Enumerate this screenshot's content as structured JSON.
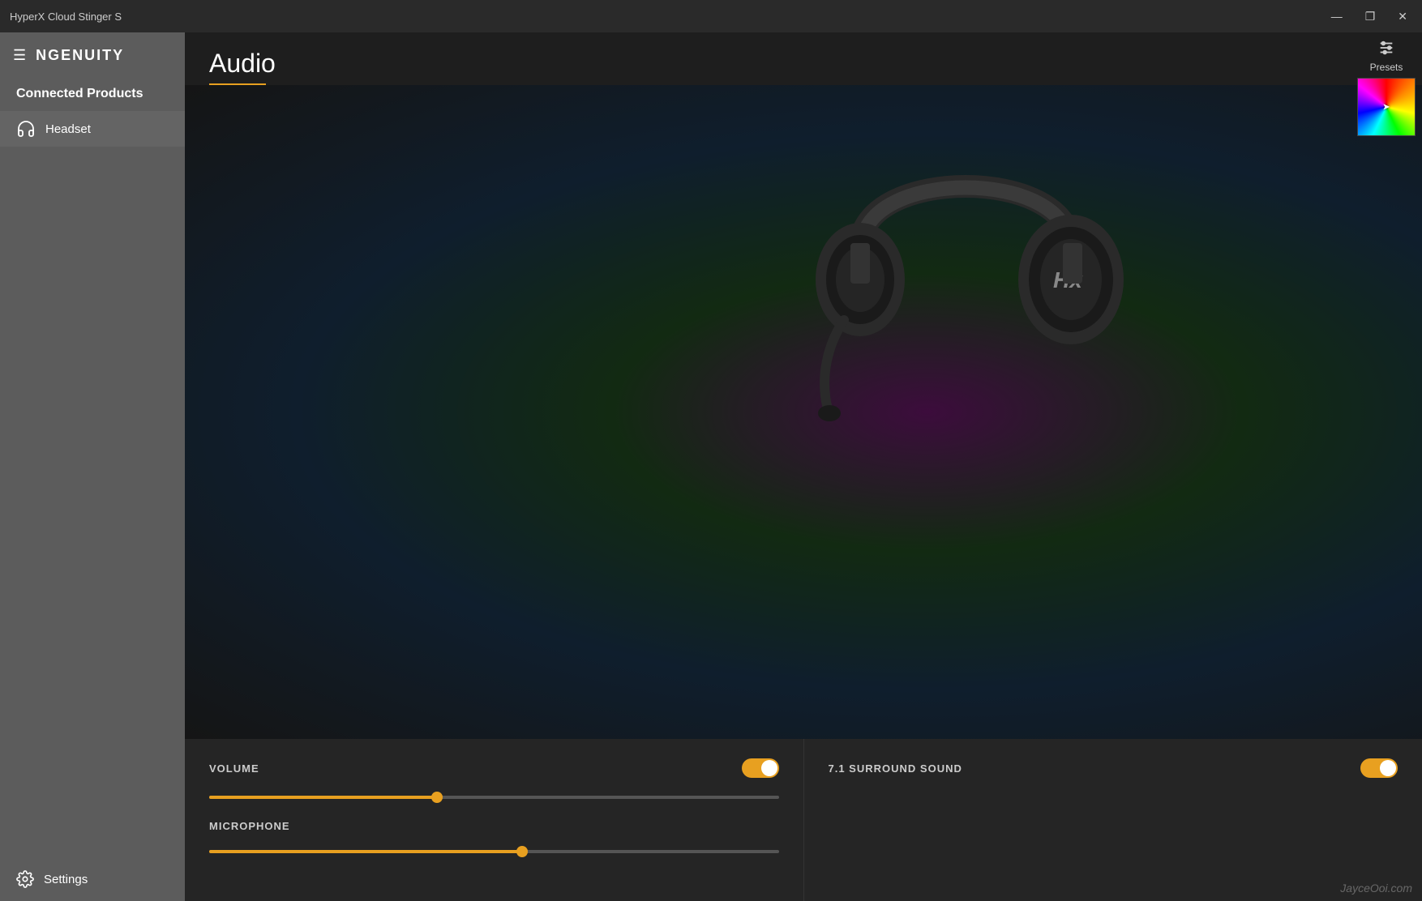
{
  "titlebar": {
    "title": "HyperX Cloud Stinger S",
    "minimize_label": "—",
    "maximize_label": "❐",
    "close_label": "✕"
  },
  "sidebar": {
    "hamburger": "☰",
    "logo": "NGENUITY",
    "connected_products_label": "Connected Products",
    "headset_label": "Headset",
    "settings_label": "Settings"
  },
  "content": {
    "page_title": "Audio",
    "presets_label": "Presets",
    "volume_label": "VOLUME",
    "volume_toggle_on": true,
    "volume_slider_pct": 40,
    "microphone_label": "MICROPHONE",
    "microphone_slider_pct": 55,
    "surround_label": "7.1 SURROUND SOUND",
    "surround_toggle_on": true
  },
  "watermark": {
    "text": "JayceOoi.com"
  }
}
